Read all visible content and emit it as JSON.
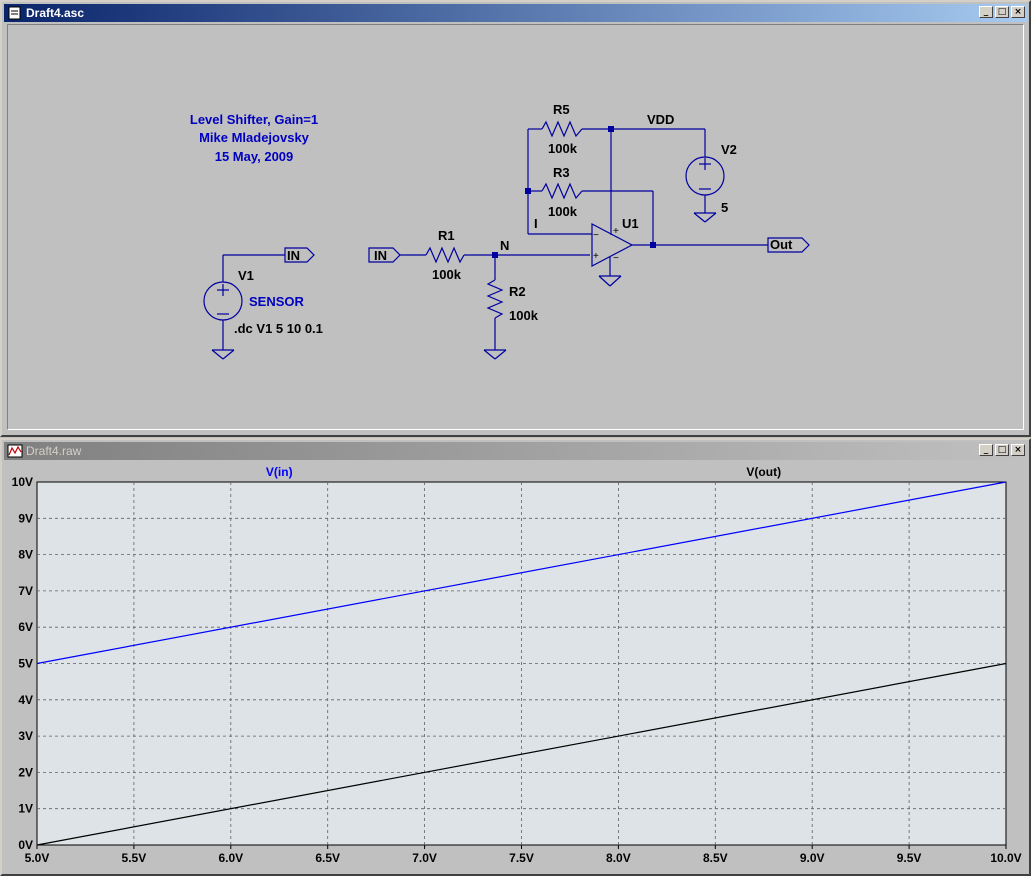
{
  "schematic_window": {
    "title": "Draft4.asc",
    "buttons": {
      "minimize": "_",
      "maximize": "□",
      "close": "×"
    },
    "comment_lines": [
      "Level Shifter, Gain=1",
      "Mike Mladejovsky",
      "15 May, 2009"
    ],
    "components": {
      "r1": {
        "name": "R1",
        "value": "100k"
      },
      "r2": {
        "name": "R2",
        "value": "100k"
      },
      "r3": {
        "name": "R3",
        "value": "100k"
      },
      "r5": {
        "name": "R5",
        "value": "100k"
      },
      "v1": {
        "name": "V1",
        "value": "SENSOR"
      },
      "v2": {
        "name": "V2",
        "value": "5"
      },
      "u1": {
        "name": "U1"
      }
    },
    "net_labels": {
      "vdd": "VDD",
      "n": "N",
      "i": "I",
      "in_port_left": "IN",
      "in_port_mid": "IN",
      "out_port": "Out"
    },
    "directive": ".dc V1 5 10 0.1",
    "colors": {
      "wire": "#0000a0",
      "text": "#000000",
      "comment": "#0000c0",
      "background": "#c0c0c0"
    }
  },
  "plot_window": {
    "title": "Draft4.raw",
    "buttons": {
      "minimize": "_",
      "maximize": "□",
      "close": "×"
    }
  },
  "chart_data": {
    "type": "line",
    "x": [
      5.0,
      10.0
    ],
    "series": [
      {
        "name": "V(in)",
        "color": "#0000ff",
        "x": [
          5.0,
          10.0
        ],
        "values": [
          5,
          10
        ]
      },
      {
        "name": "V(out)",
        "color": "#000000",
        "x": [
          5.0,
          10.0
        ],
        "values": [
          0,
          5
        ]
      }
    ],
    "xlim": [
      5.0,
      10.0
    ],
    "ylim": [
      0,
      10
    ],
    "x_ticks": [
      "5.0V",
      "5.5V",
      "6.0V",
      "6.5V",
      "7.0V",
      "7.5V",
      "8.0V",
      "8.5V",
      "9.0V",
      "9.5V",
      "10.0V"
    ],
    "y_ticks": [
      "0V",
      "1V",
      "2V",
      "3V",
      "4V",
      "5V",
      "6V",
      "7V",
      "8V",
      "9V",
      "10V"
    ],
    "grid": true,
    "plot_background": "#dde3e6"
  }
}
